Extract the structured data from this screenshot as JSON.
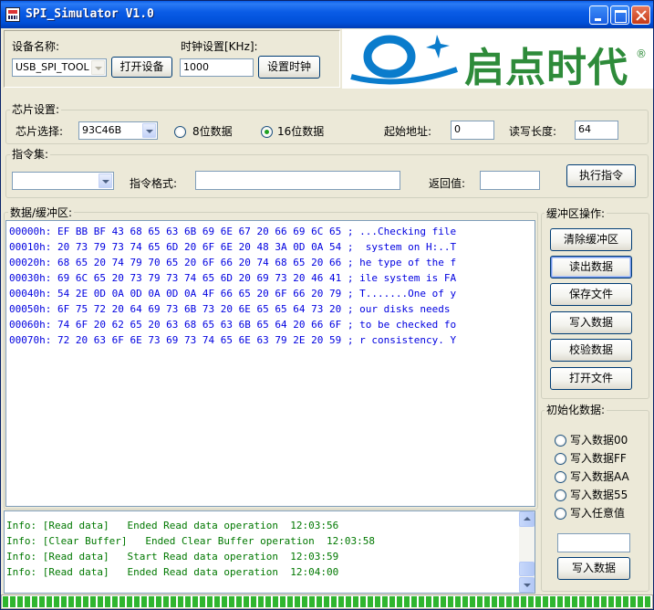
{
  "window": {
    "title": "SPI_Simulator V1.0"
  },
  "device": {
    "name_label": "设备名称:",
    "name_value": "USB_SPI_TOOL",
    "open_button": "打开设备",
    "clock_label": "时钟设置[KHz]:",
    "clock_value": "1000",
    "clock_button": "设置时钟"
  },
  "logo": {
    "text": "启点时代",
    "reg": "®",
    "color": "#2e8b3a",
    "mark_color": "#0a7ccc"
  },
  "chip": {
    "group_title": "芯片设置:",
    "select_label": "芯片选择:",
    "select_value": "93C46B",
    "radio_8": "8位数据",
    "radio_16": "16位数据",
    "radio_selected": "16",
    "start_label": "起始地址:",
    "start_value": "0",
    "length_label": "读写长度:",
    "length_value": "64"
  },
  "command": {
    "group_title": "指令集:",
    "select_value": "",
    "format_label": "指令格式:",
    "format_value": "",
    "return_label": "返回值:",
    "return_value": "",
    "exec_button": "执行指令"
  },
  "buffer": {
    "group_title": "数据/缓冲区:",
    "lines": [
      "00000h: EF BB BF 43 68 65 63 6B 69 6E 67 20 66 69 6C 65 ; ...Checking file",
      "00010h: 20 73 79 73 74 65 6D 20 6F 6E 20 48 3A 0D 0A 54 ;  system on H:..T",
      "00020h: 68 65 20 74 79 70 65 20 6F 66 20 74 68 65 20 66 ; he type of the f",
      "00030h: 69 6C 65 20 73 79 73 74 65 6D 20 69 73 20 46 41 ; ile system is FA",
      "00040h: 54 2E 0D 0A 0D 0A 0D 0A 4F 66 65 20 6F 66 20 79 ; T.......One of y",
      "00050h: 6F 75 72 20 64 69 73 6B 73 20 6E 65 65 64 73 20 ; our disks needs ",
      "00060h: 74 6F 20 62 65 20 63 68 65 63 6B 65 64 20 66 6F ; to be checked fo",
      "00070h: 72 20 63 6F 6E 73 69 73 74 65 6E 63 79 2E 20 59 ; r consistency. Y"
    ]
  },
  "buffer_ops": {
    "group_title": "缓冲区操作:",
    "clear": "清除缓冲区",
    "read": "读出数据",
    "save": "保存文件",
    "write": "写入数据",
    "verify": "校验数据",
    "open": "打开文件"
  },
  "init_data": {
    "group_title": "初始化数据:",
    "options": [
      "写入数据00",
      "写入数据FF",
      "写入数据AA",
      "写入数据55",
      "写入任意值"
    ],
    "value": "",
    "write_button": "写入数据"
  },
  "log": {
    "lines": [
      "Info: [Read data]   Ended Read data operation  12:03:56",
      "Info: [Clear Buffer]   Ended Clear Buffer operation  12:03:58",
      "Info: [Read data]   Start Read data operation  12:03:59",
      "Info: [Read data]   Ended Read data operation  12:04:00"
    ]
  },
  "progress": {
    "fraction": 1.0
  }
}
